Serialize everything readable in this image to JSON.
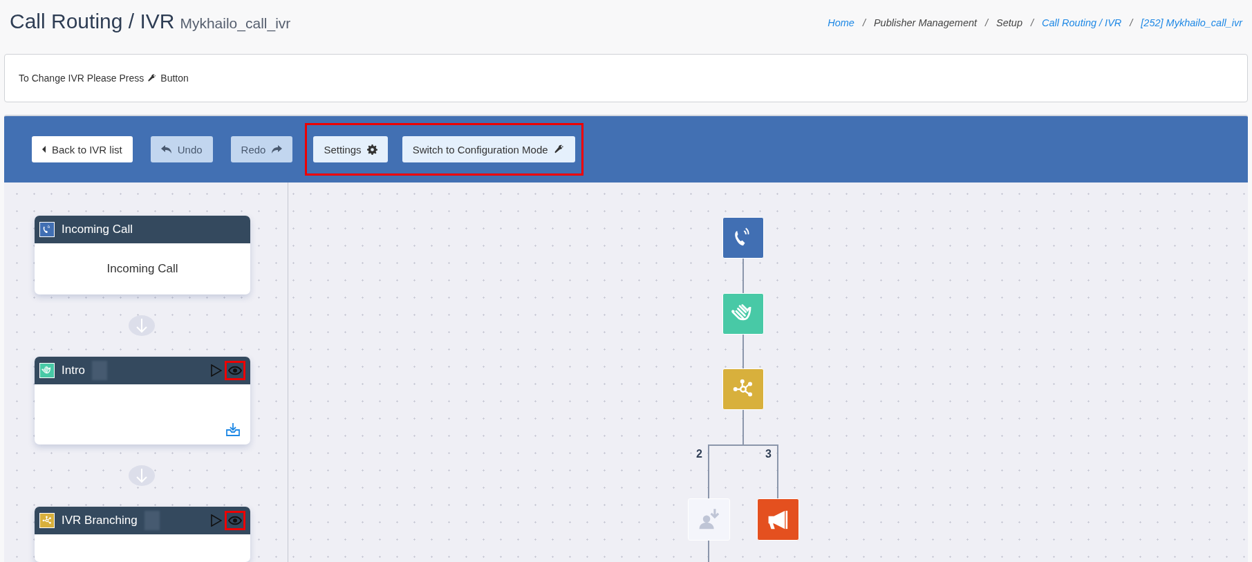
{
  "page": {
    "title": "Call Routing / IVR",
    "subtitle": "Mykhailo_call_ivr"
  },
  "breadcrumb": [
    {
      "label": "Home",
      "link": true
    },
    {
      "separator": "/",
      "label": "Publisher Management",
      "link": false
    },
    {
      "separator": "/",
      "label": "Setup",
      "link": false
    },
    {
      "separator": "/",
      "label": "Call Routing / IVR",
      "link": true
    },
    {
      "separator": "/",
      "label": "[252] Mykhailo_call_ivr",
      "link": true
    }
  ],
  "notice": {
    "before": "To Change IVR Please Press",
    "after": "Button"
  },
  "toolbar": {
    "buttons": [
      {
        "kind": "back",
        "label": "Back to IVR list",
        "disabled": false
      },
      {
        "kind": "undo",
        "label": "Undo",
        "disabled": true
      },
      {
        "kind": "redo",
        "label": "Redo",
        "disabled": true
      }
    ],
    "highlight_group": {
      "outlined": true,
      "buttons": [
        {
          "kind": "settings",
          "label": "Settings",
          "disabled": false
        },
        {
          "kind": "config",
          "label": "Switch to Configuration Mode",
          "disabled": false
        }
      ]
    }
  },
  "cards": [
    {
      "kind": "incoming",
      "title": "Incoming Call",
      "body": "Incoming Call",
      "color": "#416fb3"
    },
    {
      "kind": "intro",
      "title": "Intro",
      "redacted": true,
      "actions": true,
      "eye_highlighted": true,
      "download": true,
      "color": "#48c9a6"
    },
    {
      "kind": "branch",
      "title": "IVR Branching",
      "redacted": true,
      "actions": true,
      "eye_highlighted": true,
      "color": "#d8b03c"
    }
  ],
  "flow": [
    {
      "kind": "phone",
      "color": "#416fb3"
    },
    {
      "kind": "hand",
      "color": "#48c9a6"
    },
    {
      "kind": "branch",
      "color": "#d8b03c"
    }
  ],
  "branches": [
    {
      "label": "2",
      "kind": "transfer",
      "color": "#f4f5fb"
    },
    {
      "label": "3",
      "kind": "megaphone",
      "color": "#e4501f"
    }
  ]
}
